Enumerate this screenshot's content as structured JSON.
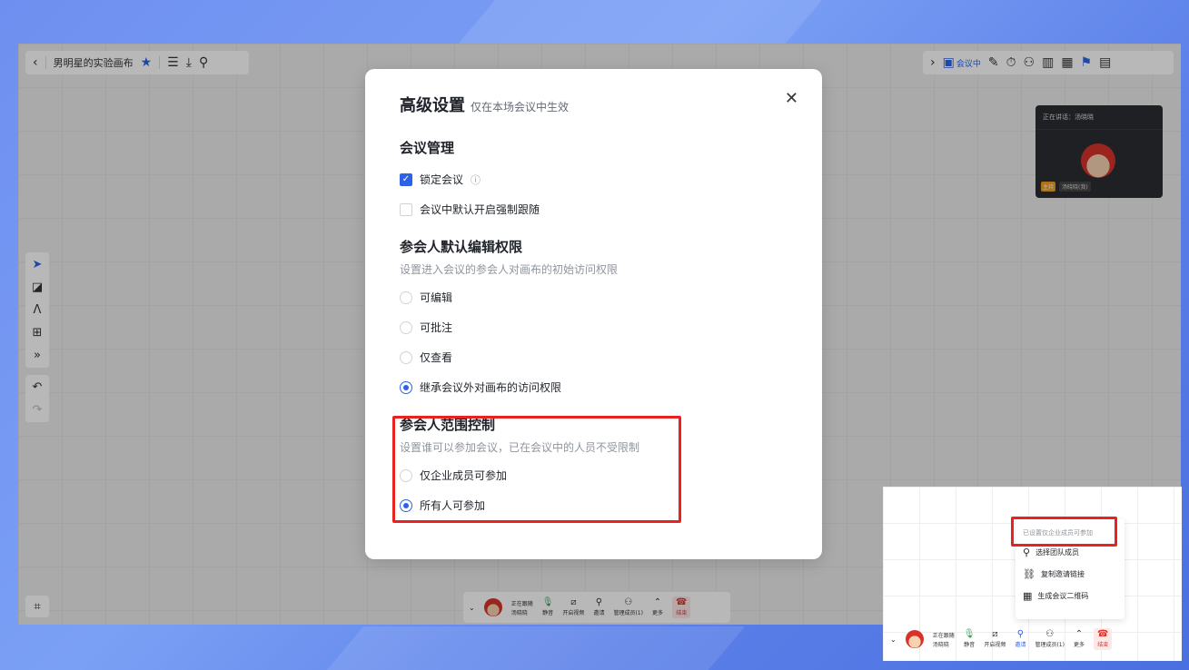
{
  "canvas": {
    "title": "男明星的实验画布"
  },
  "toolbar_right": {
    "meeting_label": "会议中"
  },
  "video": {
    "speaking_label": "正在讲话：汤晓晓",
    "host_tag": "主持",
    "host_name": "汤晓晓(我)",
    "avatar_label": "男明星"
  },
  "bottombar": {
    "follow_status": "正在跟随",
    "follow_name": "汤晓晓",
    "mute": "静音",
    "video": "开启视频",
    "invite": "邀请",
    "manage": "管理成员(1)",
    "more": "更多",
    "end": "结束"
  },
  "dialog": {
    "title": "高级设置",
    "subtitle": "仅在本场会议中生效",
    "section1": {
      "title": "会议管理",
      "lock": "锁定会议",
      "follow": "会议中默认开启强制跟随"
    },
    "section2": {
      "title": "参会人默认编辑权限",
      "desc": "设置进入会议的参会人对画布的初始访问权限",
      "opt1": "可编辑",
      "opt2": "可批注",
      "opt3": "仅查看",
      "opt4": "继承会议外对画布的访问权限"
    },
    "section3": {
      "title": "参会人范围控制",
      "desc": "设置谁可以参加会议，已在会议中的人员不受限制",
      "opt1": "仅企业成员可参加",
      "opt2": "所有人可参加"
    }
  },
  "inset": {
    "hint": "已设置仅企业成员可参加",
    "item1": "选择团队成员",
    "item2": "复制邀请链接",
    "item3": "生成会议二维码"
  }
}
